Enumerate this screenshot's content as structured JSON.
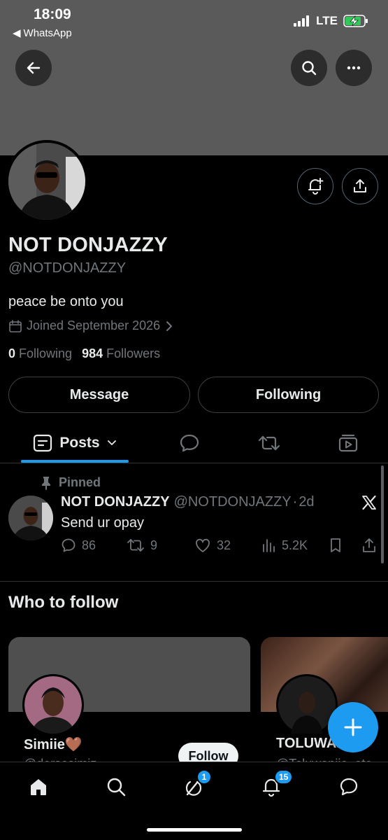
{
  "status_bar": {
    "time": "18:09",
    "back_app": "WhatsApp",
    "network": "LTE"
  },
  "profile": {
    "name": "NOT DONJAZZY",
    "handle": "@NOTDONJAZZY",
    "bio": "peace be onto you",
    "joined": "Joined September 2026",
    "following_count": "0",
    "following_label": "Following",
    "followers_count": "984",
    "followers_label": "Followers",
    "message_button": "Message",
    "following_button": "Following"
  },
  "tabs": {
    "posts_label": "Posts"
  },
  "pinned_post": {
    "pinned_label": "Pinned",
    "author_name": "NOT DONJAZZY",
    "author_handle": "@NOTDONJAZZY",
    "separator": "·",
    "age": "2d",
    "text": "Send ur opay",
    "replies": "86",
    "reposts": "9",
    "likes": "32",
    "views": "5.2K"
  },
  "who_to_follow": {
    "title": "Who to follow",
    "cards": [
      {
        "name": "Simiie🤎",
        "handle": "@dersosimiz",
        "follow_label": "Follow"
      },
      {
        "name": "TOLUWANIJO",
        "handle": "@Toluwanijo_ete"
      }
    ]
  },
  "bottom_nav": {
    "chat_badge": "1",
    "notifications_badge": "15"
  },
  "colors": {
    "accent": "#1d9bf0",
    "banner": "#5a5a5a",
    "background": "#000000",
    "muted_text": "#71767b"
  }
}
